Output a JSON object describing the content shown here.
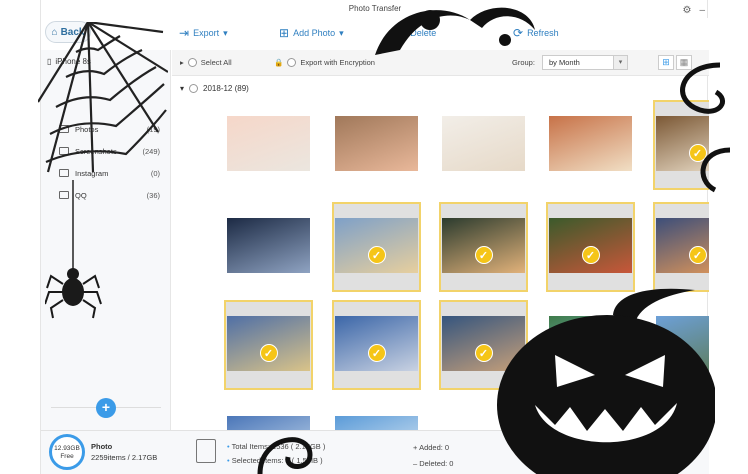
{
  "window": {
    "title": "Photo Transfer"
  },
  "toolbar": {
    "back_label": "Back",
    "export_label": "Export",
    "add_photo_label": "Add Photo",
    "delete_label": "Delete",
    "refresh_label": "Refresh"
  },
  "sidebar": {
    "device_name": "iPhone 8s",
    "items": [
      {
        "label": "Photos",
        "count": "(19)"
      },
      {
        "label": "Screenshots",
        "count": "(249)"
      },
      {
        "label": "Instagram",
        "count": "(0)"
      },
      {
        "label": "QQ",
        "count": "(36)"
      }
    ],
    "add_label": "+"
  },
  "filters": {
    "select_all": "Select All",
    "export_encryption": "Export with Encryption",
    "group_label": "Group:",
    "group_value": "by Month"
  },
  "group": {
    "label": "2018-12 (89)"
  },
  "thumbnails": [
    {
      "colors": [
        "#f6d7c9",
        "#ebe6df"
      ]
    },
    {
      "colors": [
        "#a0785a",
        "#e9b89a"
      ]
    },
    {
      "colors": [
        "#f2eee8",
        "#e6d9c8"
      ]
    },
    {
      "colors": [
        "#c77248",
        "#f1dfc5"
      ]
    },
    {
      "colors": [
        "#7b5835",
        "#efe3cf"
      ]
    },
    {
      "colors": [
        "#1c2a44",
        "#8fa3c2"
      ]
    },
    {
      "colors": [
        "#7ea0c8",
        "#e7cf9e"
      ]
    },
    {
      "colors": [
        "#2b3b2e",
        "#e2b27a"
      ]
    },
    {
      "colors": [
        "#3b5a2b",
        "#c8573a"
      ]
    },
    {
      "colors": [
        "#3c4e7a",
        "#e69a58"
      ]
    },
    {
      "colors": [
        "#4f6fa6",
        "#d9c389"
      ]
    },
    {
      "colors": [
        "#3b66a8",
        "#c9d2e2"
      ]
    },
    {
      "colors": [
        "#35557e",
        "#c7a07a"
      ]
    },
    {
      "colors": [
        "#3e7b4a",
        "#8ac0e0"
      ]
    },
    {
      "colors": [
        "#6da0d8",
        "#5c7a52"
      ]
    },
    {
      "colors": [
        "#4b76b8",
        "#cfe2f2"
      ]
    },
    {
      "colors": [
        "#5b9bd8",
        "#e9f1f7"
      ]
    }
  ],
  "footer": {
    "storage_size": "12.93GB",
    "storage_label": "Free",
    "photo_title": "Photo",
    "photo_stats": "2259items / 2.17GB",
    "total_items": "Total Items: 1536 ( 2.17GB )",
    "selected_items": "Selected Items: 8 ( 1.5MB )",
    "added": "Added: 0",
    "deleted": "Deleted: 0"
  },
  "colors": {
    "accent": "#3b9be8",
    "selected": "#f5c518"
  }
}
